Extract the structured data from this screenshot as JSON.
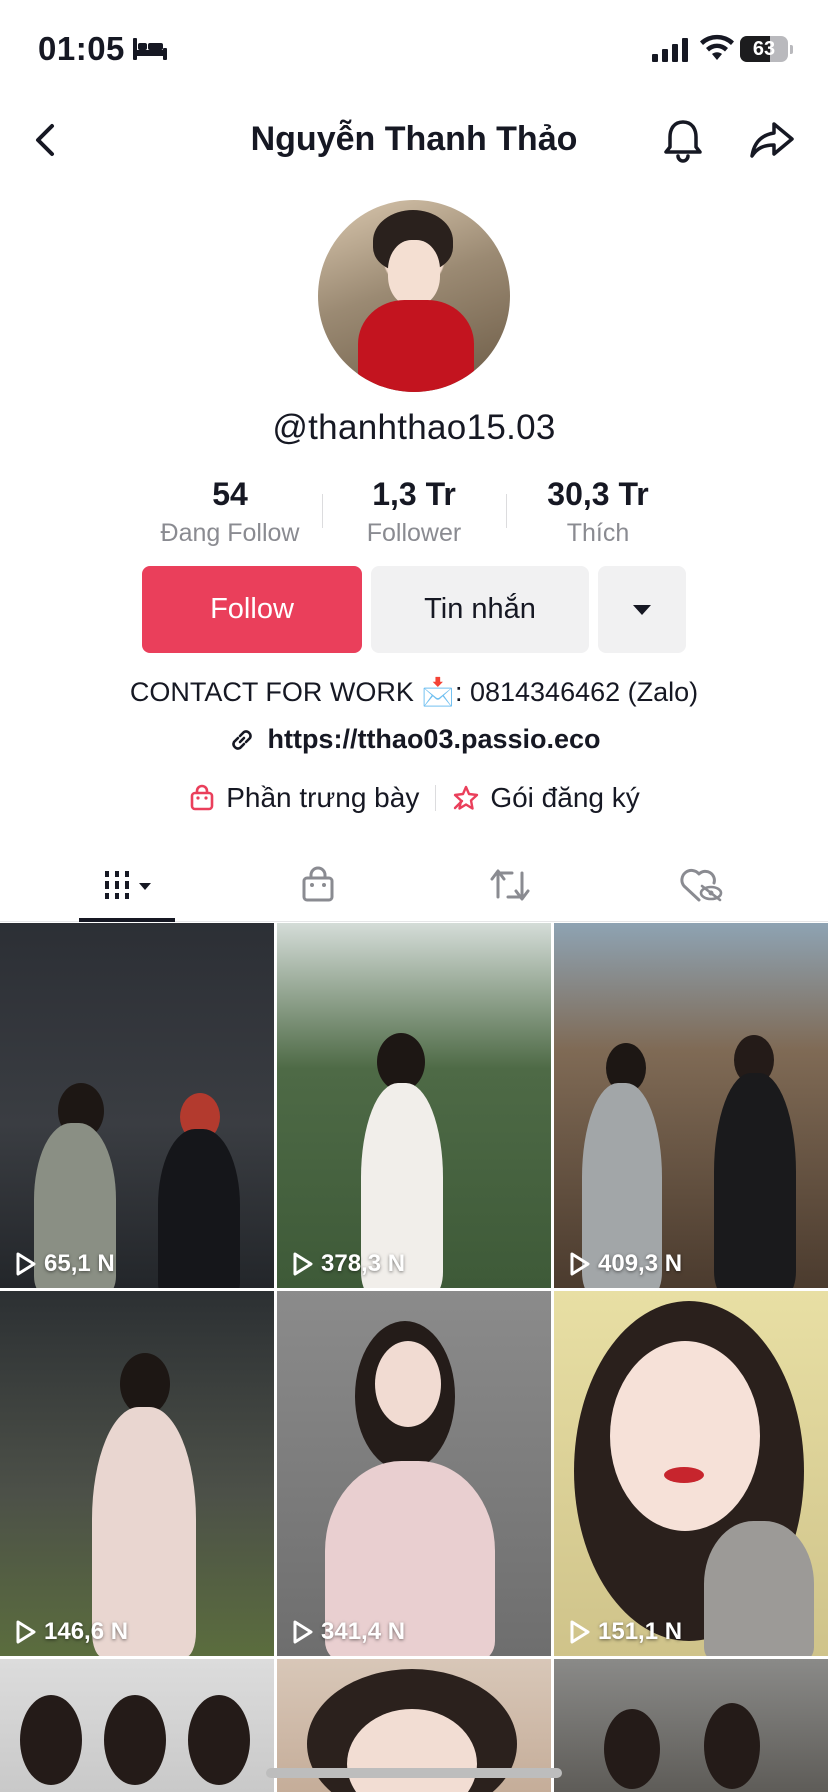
{
  "status_bar": {
    "time": "01:05",
    "battery": "63",
    "battery_level": 0.63
  },
  "header": {
    "title": "Nguyễn Thanh Thảo"
  },
  "profile": {
    "handle": "@thanhthao15.03",
    "stats": [
      {
        "value": "54",
        "label": "Đang Follow"
      },
      {
        "value": "1,3 Tr",
        "label": "Follower"
      },
      {
        "value": "30,3 Tr",
        "label": "Thích"
      }
    ],
    "follow_label": "Follow",
    "message_label": "Tin nhắn",
    "bio_prefix": "CONTACT FOR WORK ",
    "bio_emoji": "📩",
    "bio_suffix": ": 0814346462 (Zalo)",
    "link": "https://tthao03.passio.eco",
    "showcase_label": "Phần trưng bày",
    "subscription_label": "Gói đăng ký"
  },
  "tabs": [
    {
      "name": "videos",
      "icon": "grid-icon",
      "active": true
    },
    {
      "name": "shop",
      "icon": "bag-icon",
      "active": false
    },
    {
      "name": "reposts",
      "icon": "repost-icon",
      "active": false
    },
    {
      "name": "liked",
      "icon": "hidden-heart-icon",
      "active": false
    }
  ],
  "videos": [
    {
      "views": "65,1 N"
    },
    {
      "views": "378,3 N"
    },
    {
      "views": "409,3 N"
    },
    {
      "views": "146,6 N"
    },
    {
      "views": "341,4 N"
    },
    {
      "views": "151,1 N"
    },
    {
      "views": ""
    },
    {
      "views": ""
    },
    {
      "views": ""
    }
  ],
  "colors": {
    "accent": "#ea3f5b",
    "text": "#161823",
    "muted": "#8a8b91"
  }
}
